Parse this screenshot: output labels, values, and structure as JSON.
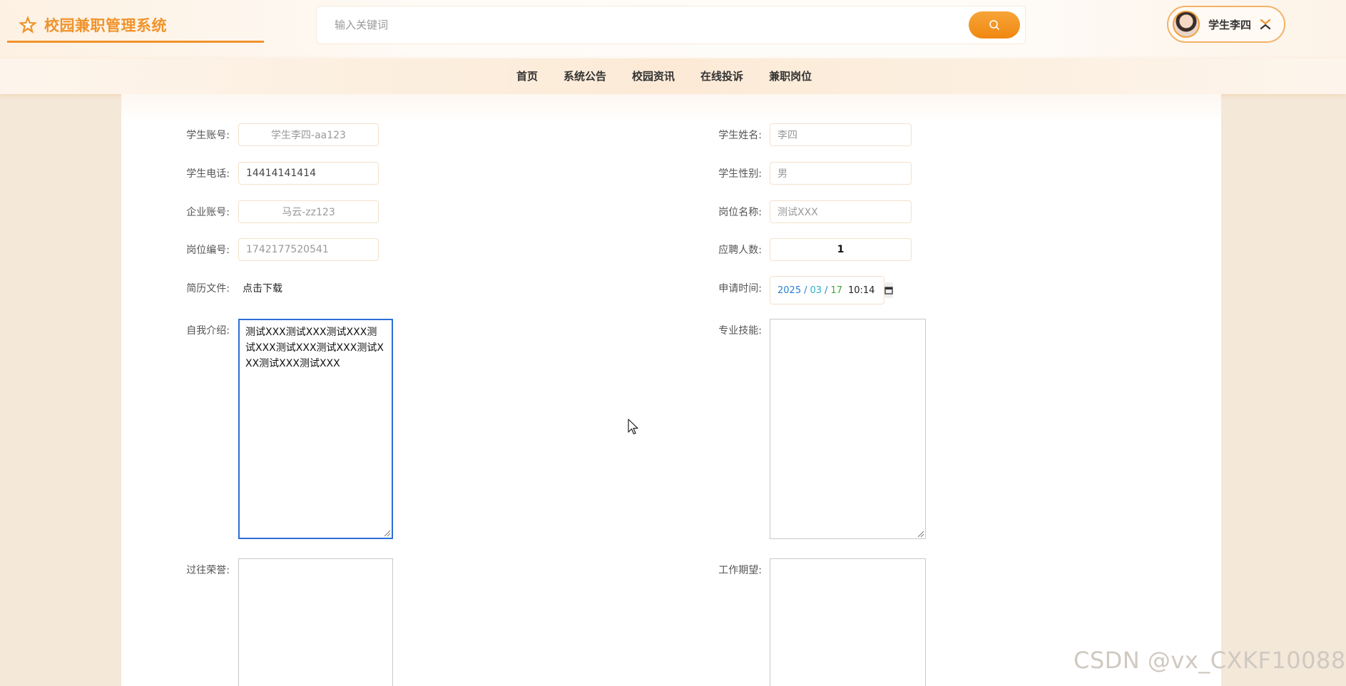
{
  "header": {
    "app_title": "校园兼职管理系统",
    "search_placeholder": "输入关键词",
    "user_name": "学生李四",
    "accent_color": "#f0932b"
  },
  "nav": {
    "items": [
      "首页",
      "系统公告",
      "校园资讯",
      "在线投诉",
      "兼职岗位"
    ]
  },
  "form": {
    "student_account": {
      "label": "学生账号:",
      "value": "学生李四-aa123"
    },
    "student_name": {
      "label": "学生姓名:",
      "value": "李四"
    },
    "student_phone": {
      "label": "学生电话:",
      "value": "14414141414"
    },
    "student_gender": {
      "label": "学生性别:",
      "value": "男"
    },
    "company_account": {
      "label": "企业账号:",
      "value": "马云-zz123"
    },
    "job_name": {
      "label": "岗位名称:",
      "value": "测试XXX"
    },
    "job_number": {
      "label": "岗位编号:",
      "value": "1742177520541"
    },
    "applicant_count": {
      "label": "应聘人数:",
      "value": "1"
    },
    "resume_file": {
      "label": "简历文件:",
      "value": "点击下载"
    },
    "apply_time": {
      "label": "申请时间:",
      "year": "2025",
      "sep": "/",
      "month": "03",
      "day": "17",
      "time": "10:14"
    },
    "self_intro": {
      "label": "自我介绍:",
      "value": "测试XXX测试XXX测试XXX测试XXX测试XXX测试XXX测试XXX测试XXX测试XXX"
    },
    "skills": {
      "label": "专业技能:",
      "value": ""
    },
    "honors": {
      "label": "过往荣誉:",
      "value": ""
    },
    "expectation": {
      "label": "工作期望:",
      "value": ""
    }
  },
  "watermark": "CSDN @vx_CXKF10088"
}
